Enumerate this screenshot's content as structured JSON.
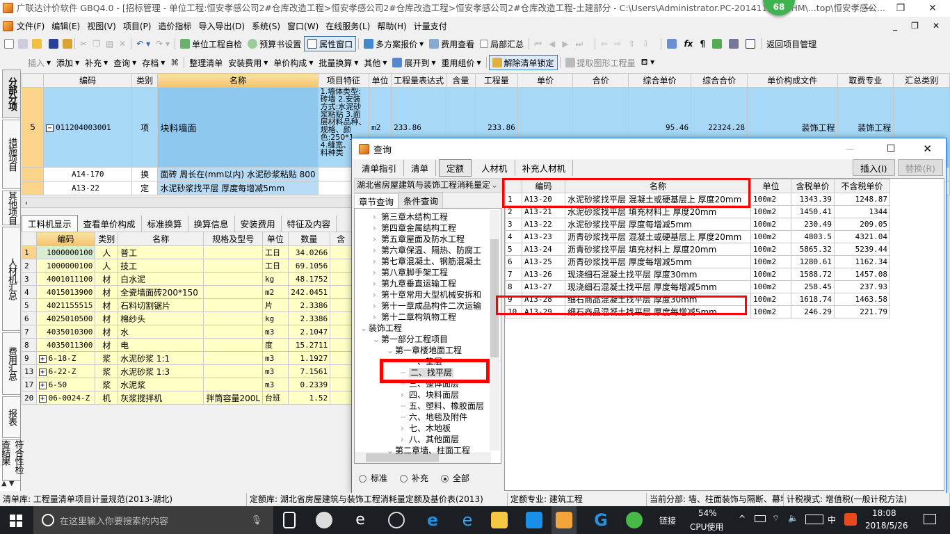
{
  "title_bar": {
    "text": "广联达计价软件 GBQ4.0 - [招标管理 - 单位工程:恒安孝感公司2#仓库改造工程>恒安孝感公司2#仓库改造工程>恒安孝感公司2#仓库改造工程-土建部分 - C:\\Users\\Administrator.PC-20141127NRHM\\...top\\恒安孝感公...",
    "badge": "68"
  },
  "menu": [
    "文件(F)",
    "编辑(E)",
    "视图(V)",
    "项目(P)",
    "造价指标",
    "导入导出(D)",
    "系统(S)",
    "窗口(W)",
    "在线服务(L)",
    "帮助(H)",
    "计量支付"
  ],
  "toolbar1": {
    "self_check": "单位工程自检",
    "budget_settings": "预算书设置",
    "property_window": "属性窗口",
    "multi_quote": "多方案报价",
    "fee_view": "费用查看",
    "partial_summary": "局部汇总",
    "return_project": "返回项目管理"
  },
  "toolbar2": [
    "插入",
    "添加",
    "补充",
    "查询",
    "存档",
    "整理清单",
    "安装费用",
    "单价构成",
    "批量换算",
    "其他",
    "展开到",
    "重用组价",
    "解除清单锁定",
    "提取图形工程量"
  ],
  "left_tabs": [
    "分部分项",
    "措施项目",
    "其他项目",
    "人材机汇总",
    "费用汇总",
    "报表",
    "符合性检查结果"
  ],
  "top_grid": {
    "headers": [
      "",
      "编码",
      "类别",
      "名称",
      "项目特征",
      "单位",
      "工程量表达式",
      "含量",
      "工程量",
      "单价",
      "合价",
      "综合单价",
      "综合合价",
      "单价构成文件",
      "取费专业",
      "汇总类别"
    ],
    "main_row": {
      "no": "5",
      "code": "011204003001",
      "type": "项",
      "name": "块料墙面",
      "feature": "1.墙体类型:砖墙 2.安装方式:水泥砂浆粘贴 3.面层材料品种、规格、颜色:250*1... 4.缝宽、...材料种类",
      "unit": "m2",
      "expr": "233.86",
      "qty": "233.86",
      "unit_total": "95.46",
      "total": "22324.28",
      "price_file": "装饰工程",
      "fee_major": "装饰工程"
    },
    "sub_rows": [
      {
        "code": "A14-170",
        "type": "换",
        "name": "面砖 周长在(mm以内) 水泥砂浆粘贴 800"
      },
      {
        "code": "A13-22",
        "type": "定",
        "name": "水泥砂浆找平层 厚度每增减5mm"
      }
    ]
  },
  "bottom_tabs": [
    "工料机显示",
    "查看单价构成",
    "标准换算",
    "换算信息",
    "安装费用",
    "特征及内容"
  ],
  "bottom_grid": {
    "headers": [
      "",
      "编码",
      "类别",
      "名称",
      "规格及型号",
      "单位",
      "数量",
      "含"
    ],
    "rows": [
      {
        "no": "1",
        "code": "1000000100",
        "type": "人",
        "name": "普工",
        "spec": "",
        "unit": "工日",
        "qty": "34.0266"
      },
      {
        "no": "2",
        "code": "1000000100",
        "type": "人",
        "name": "技工",
        "spec": "",
        "unit": "工日",
        "qty": "69.1056"
      },
      {
        "no": "3",
        "code": "4001011100",
        "type": "材",
        "name": "白水泥",
        "spec": "",
        "unit": "kg",
        "qty": "48.1752"
      },
      {
        "no": "4",
        "code": "4015013900",
        "type": "材",
        "name": "全瓷墙面砖200*150",
        "spec": "",
        "unit": "m2",
        "qty": "242.0451"
      },
      {
        "no": "5",
        "code": "4021155515",
        "type": "材",
        "name": "石料切割锯片",
        "spec": "",
        "unit": "片",
        "qty": "2.3386"
      },
      {
        "no": "6",
        "code": "4025010500",
        "type": "材",
        "name": "棉纱头",
        "spec": "",
        "unit": "kg",
        "qty": "2.3386"
      },
      {
        "no": "7",
        "code": "4035010300",
        "type": "材",
        "name": "水",
        "spec": "",
        "unit": "m3",
        "qty": "2.1047"
      },
      {
        "no": "8",
        "code": "4035011300",
        "type": "材",
        "name": "电",
        "spec": "",
        "unit": "度",
        "qty": "15.2711"
      },
      {
        "no": "9",
        "code": "6-18-Z",
        "type": "浆",
        "name": "水泥砂浆 1:1",
        "spec": "",
        "unit": "m3",
        "qty": "1.1927",
        "expand": true
      },
      {
        "no": "13",
        "code": "6-22-Z",
        "type": "浆",
        "name": "水泥砂浆 1:3",
        "spec": "",
        "unit": "m3",
        "qty": "7.1561",
        "expand": true
      },
      {
        "no": "17",
        "code": "6-50",
        "type": "浆",
        "name": "水泥浆",
        "spec": "",
        "unit": "m3",
        "qty": "0.2339",
        "expand": true
      },
      {
        "no": "20",
        "code": "06-0024-Z",
        "type": "机",
        "name": "灰浆搅拌机",
        "spec": "拌筒容量200L",
        "unit": "台班",
        "qty": "1.52",
        "expand": true
      }
    ]
  },
  "dialog": {
    "title": "查询",
    "tabs": [
      "清单指引",
      "清单",
      "定额",
      "人材机",
      "补充人材机"
    ],
    "insert_button": "插入(I)",
    "replace_button": "替换(R)",
    "library_select": "湖北省房屋建筑与装饰工程消耗量定",
    "search_tabs": [
      "章节查询",
      "条件查询"
    ],
    "tree": [
      {
        "label": "第三章木结构工程",
        "level": 2,
        "icon": "chevron-right"
      },
      {
        "label": "第四章金属结构工程",
        "level": 2,
        "icon": "chevron-right"
      },
      {
        "label": "第五章屋面及防水工程",
        "level": 2,
        "icon": "chevron-right"
      },
      {
        "label": "第六章保温、隔热、防腐工",
        "level": 2,
        "icon": "chevron-right"
      },
      {
        "label": "第七章混凝土、钢筋混凝土",
        "level": 2,
        "icon": "chevron-right"
      },
      {
        "label": "第八章脚手架工程",
        "level": 2,
        "icon": "chevron-right"
      },
      {
        "label": "第九章垂直运输工程",
        "level": 2,
        "icon": "chevron-right"
      },
      {
        "label": "第十章常用大型机械安拆和",
        "level": 2,
        "icon": "chevron-right"
      },
      {
        "label": "第十一章成品构件二次运输",
        "level": 2,
        "icon": "chevron-right"
      },
      {
        "label": "第十二章构筑物工程",
        "level": 2,
        "icon": "chevron-right"
      },
      {
        "label": "装饰工程",
        "level": 1,
        "icon": "chevron-down"
      },
      {
        "label": "第一部分工程项目",
        "level": 2,
        "icon": "chevron-down"
      },
      {
        "label": "第一章楼地面工程",
        "level": 3,
        "icon": "chevron-down"
      },
      {
        "label": "一、垫层",
        "level": 4,
        "icon": "none"
      },
      {
        "label": "二、找平层",
        "level": 4,
        "icon": "none",
        "selected": true
      },
      {
        "label": "三、整体面层",
        "level": 4,
        "icon": "none"
      },
      {
        "label": "四、块料面层",
        "level": 4,
        "icon": "chevron-right"
      },
      {
        "label": "五、塑料、橡胶面层",
        "level": 4,
        "icon": "none"
      },
      {
        "label": "六、地毯及附件",
        "level": 4,
        "icon": "none"
      },
      {
        "label": "七、木地板",
        "level": 4,
        "icon": "chevron-right"
      },
      {
        "label": "八、其他面层",
        "level": 4,
        "icon": "chevron-right"
      },
      {
        "label": "第二章墙、柱面工程",
        "level": 3,
        "icon": "chevron-down"
      }
    ],
    "radios": [
      {
        "label": "标准",
        "checked": false
      },
      {
        "label": "补充",
        "checked": false
      },
      {
        "label": "全部",
        "checked": true
      }
    ],
    "grid": {
      "headers": [
        "",
        "编码",
        "名称",
        "单位",
        "含税单价",
        "不含税单价"
      ],
      "rows": [
        {
          "no": "1",
          "code": "A13-20",
          "name": "水泥砂浆找平层 混凝土或硬基层上 厚度20mm",
          "unit": "100m2",
          "tax": "1343.39",
          "notax": "1248.87"
        },
        {
          "no": "2",
          "code": "A13-21",
          "name": "水泥砂浆找平层 填充材料上 厚度20mm",
          "unit": "100m2",
          "tax": "1450.41",
          "notax": "1344"
        },
        {
          "no": "3",
          "code": "A13-22",
          "name": "水泥砂浆找平层 厚度每增减5mm",
          "unit": "100m2",
          "tax": "230.49",
          "notax": "209.05",
          "selected": true
        },
        {
          "no": "4",
          "code": "A13-23",
          "name": "沥青砂浆找平层 混凝土或硬基层上 厚度20mm",
          "unit": "100m2",
          "tax": "4803.5",
          "notax": "4321.04"
        },
        {
          "no": "5",
          "code": "A13-24",
          "name": "沥青砂浆找平层 填充材料上 厚度20mm",
          "unit": "100m2",
          "tax": "5865.32",
          "notax": "5239.44"
        },
        {
          "no": "6",
          "code": "A13-25",
          "name": "沥青砂浆找平层 厚度每增减5mm",
          "unit": "100m2",
          "tax": "1280.61",
          "notax": "1162.34"
        },
        {
          "no": "7",
          "code": "A13-26",
          "name": "现浇细石混凝土找平层 厚度30mm",
          "unit": "100m2",
          "tax": "1588.72",
          "notax": "1457.08"
        },
        {
          "no": "8",
          "code": "A13-27",
          "name": "现浇细石混凝土找平层 厚度每增减5mm",
          "unit": "100m2",
          "tax": "258.45",
          "notax": "237.93"
        },
        {
          "no": "9",
          "code": "A13-28",
          "name": "细石商品混凝土找平层 厚度30mm",
          "unit": "100m2",
          "tax": "1618.74",
          "notax": "1463.58"
        },
        {
          "no": "10",
          "code": "A13-29",
          "name": "细石商品混凝土找平层 厚度每增减5mm",
          "unit": "100m2",
          "tax": "246.29",
          "notax": "221.79"
        }
      ]
    }
  },
  "status_bar": [
    "清单库: 工程量清单项目计量规范(2013-湖北)",
    "定额库: 湖北省房屋建筑与装饰工程消耗量定额及基价表(2013)",
    "定额专业: 建筑工程",
    "当前分部: 墙、柱面装饰与隔断、幕墙工程",
    "计税模式: 增值税(一般计税方法)"
  ],
  "taskbar": {
    "search_placeholder": "在这里输入你要搜索的内容",
    "link": "链接",
    "cpu_percent": "54%",
    "cpu_label": "CPU使用",
    "ime": "中",
    "time": "18:08",
    "date": "2018/5/26"
  },
  "colors": {
    "highlight": "#ff0000",
    "selected_row": "#a8d8f8",
    "header_selected": "#f4c36a",
    "resource_bg": "#ffffc6"
  }
}
